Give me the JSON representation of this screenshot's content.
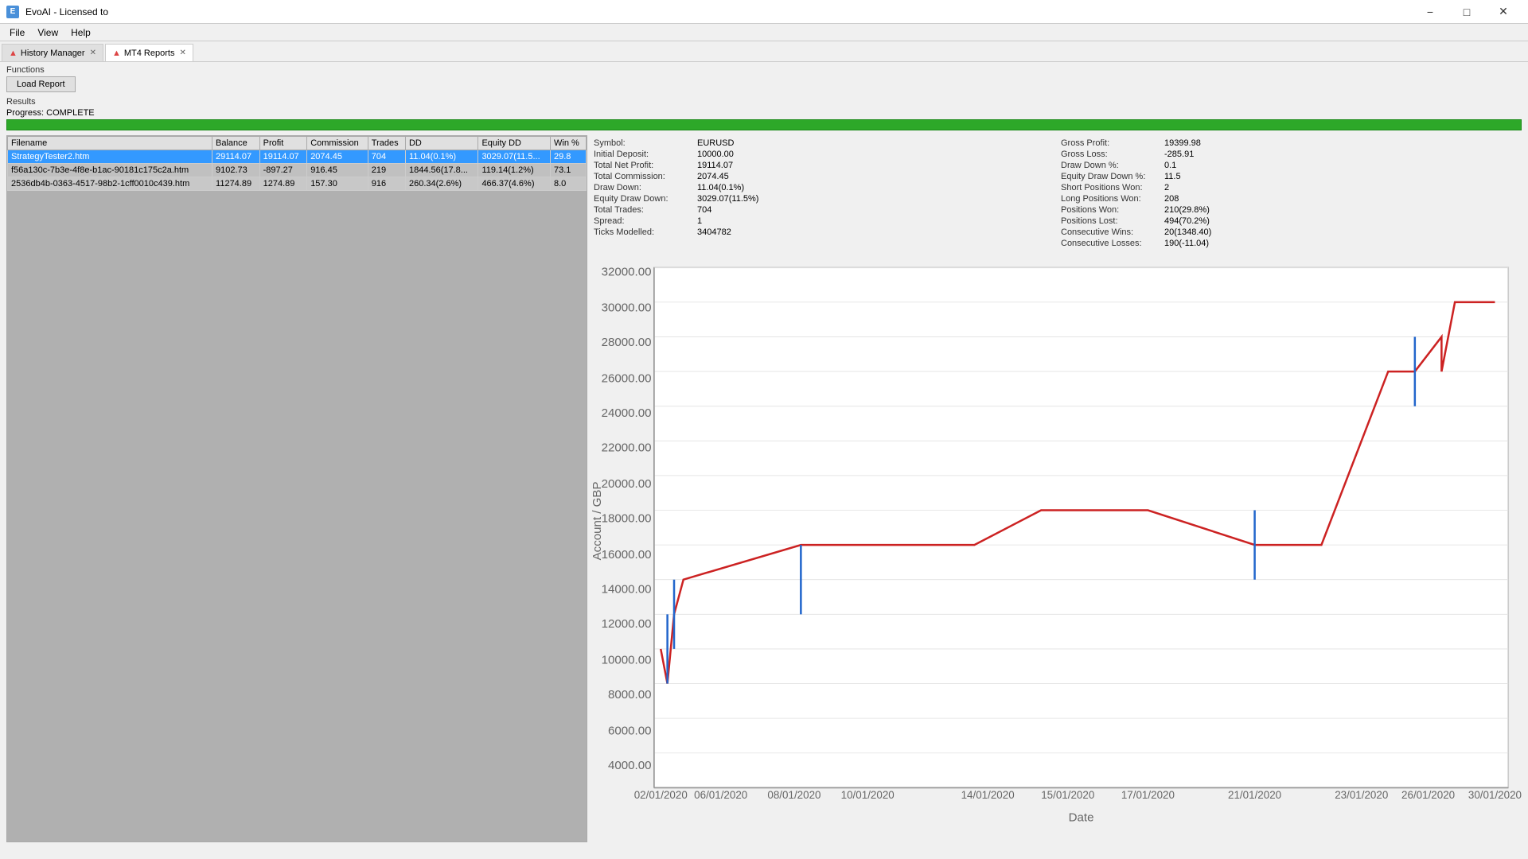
{
  "app": {
    "title": "EvoAI - Licensed to",
    "icon_label": "E"
  },
  "menu": {
    "items": [
      "File",
      "View",
      "Help"
    ]
  },
  "tabs": [
    {
      "id": "history-manager",
      "label": "History Manager",
      "active": false,
      "closeable": true,
      "icon": "chart-icon"
    },
    {
      "id": "mt4-reports",
      "label": "MT4 Reports",
      "active": true,
      "closeable": true,
      "icon": "report-icon"
    }
  ],
  "functions": {
    "label": "Functions",
    "load_report_btn": "Load Report"
  },
  "results": {
    "label": "Results",
    "progress_label": "Progress: COMPLETE"
  },
  "table": {
    "columns": [
      "Filename",
      "Balance",
      "Profit",
      "Commission",
      "Trades",
      "DD",
      "Equity DD",
      "Win %"
    ],
    "rows": [
      {
        "filename": "StrategyTester2.htm",
        "balance": "29114.07",
        "profit": "19114.07",
        "commission": "2074.45",
        "trades": "704",
        "dd": "11.04(0.1%)",
        "equity_dd": "3029.07(11.5...",
        "win_pct": "29.8",
        "selected": true
      },
      {
        "filename": "f56a130c-7b3e-4f8e-b1ac-90181c175c2a.htm",
        "balance": "9102.73",
        "profit": "-897.27",
        "commission": "916.45",
        "trades": "219",
        "dd": "1844.56(17.8...",
        "equity_dd": "119.14(1.2%)",
        "win_pct": "73.1",
        "selected": false
      },
      {
        "filename": "2536db4b-0363-4517-98b2-1cff0010c439.htm",
        "balance": "11274.89",
        "profit": "1274.89",
        "commission": "157.30",
        "trades": "916",
        "dd": "260.34(2.6%)",
        "equity_dd": "466.37(4.6%)",
        "win_pct": "8.0",
        "selected": false
      }
    ]
  },
  "stats": {
    "col1": [
      {
        "label": "Symbol:",
        "value": "EURUSD"
      },
      {
        "label": "Initial Deposit:",
        "value": "10000.00"
      },
      {
        "label": "Total Net Profit:",
        "value": "19114.07"
      },
      {
        "label": "Total Commission:",
        "value": "2074.45"
      },
      {
        "label": "Draw Down:",
        "value": "11.04(0.1%)"
      },
      {
        "label": "Equity Draw Down:",
        "value": "3029.07(11.5%)"
      },
      {
        "label": "Total Trades:",
        "value": "704"
      },
      {
        "label": "Spread:",
        "value": "1"
      },
      {
        "label": "Ticks Modelled:",
        "value": "3404782"
      }
    ],
    "col2": [
      {
        "label": "Gross Profit:",
        "value": "19399.98"
      },
      {
        "label": "Gross Loss:",
        "value": "-285.91"
      },
      {
        "label": "Draw Down %:",
        "value": "0.1"
      },
      {
        "label": "Equity Draw Down %:",
        "value": "11.5"
      },
      {
        "label": "Short Positions Won:",
        "value": "2"
      },
      {
        "label": "Long Positions Won:",
        "value": "208"
      },
      {
        "label": "Positions Won:",
        "value": "210(29.8%)"
      },
      {
        "label": "Positions Lost:",
        "value": "494(70.2%)"
      },
      {
        "label": "Consecutive Wins:",
        "value": "20(1348.40)"
      },
      {
        "label": "Consecutive Losses:",
        "value": "190(-11.04)"
      }
    ]
  },
  "chart": {
    "y_labels": [
      "32000.00",
      "30000.00",
      "28000.00",
      "26000.00",
      "24000.00",
      "22000.00",
      "20000.00",
      "18000.00",
      "16000.00",
      "14000.00",
      "12000.00",
      "10000.00",
      "8000.00",
      "6000.00",
      "4000.00"
    ],
    "x_labels": [
      "02/01/2020",
      "06/01/2020",
      "08/01/2020",
      "10/01/2020",
      "14/01/2020",
      "15/01/2020",
      "17/01/2020",
      "21/01/2020",
      "23/01/2020",
      "26/01/2020",
      "30/01/2020"
    ],
    "y_axis_label": "Account / GBP",
    "x_axis_label": "Date"
  },
  "colors": {
    "selected_row": "#3399ff",
    "progress_bar": "#2da829",
    "tab_active": "#ffffff",
    "tab_inactive": "#e0e0e0"
  }
}
